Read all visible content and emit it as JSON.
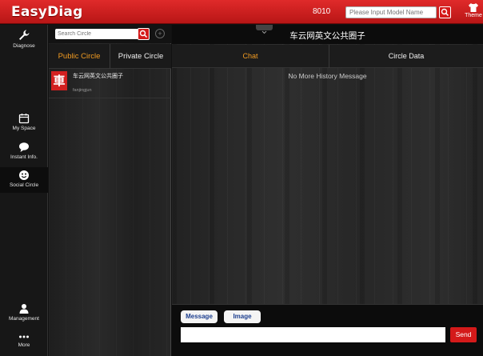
{
  "app": {
    "logo": "EasyDiag",
    "model_code": "8010",
    "model_search_placeholder": "Please Input Model Name",
    "theme_label": "Theme"
  },
  "nav": {
    "items": [
      {
        "label": "Diagnose",
        "icon": "wrench-icon"
      },
      {
        "label": "My Space",
        "icon": "calendar-icon"
      },
      {
        "label": "Instant Info.",
        "icon": "chat-bubble-icon"
      },
      {
        "label": "Social Circle",
        "icon": "smiley-icon"
      },
      {
        "label": "Management",
        "icon": "person-icon"
      },
      {
        "label": "More",
        "icon": "ellipsis-icon"
      }
    ],
    "active": "Social Circle"
  },
  "circles": {
    "search_placeholder": "Search Circle",
    "tabs": [
      {
        "label": "Public Circle",
        "active": true
      },
      {
        "label": "Private Circle",
        "active": false
      }
    ],
    "items": [
      {
        "avatar_char": "車",
        "name": "车云网英文公共圈子",
        "owner": "fanjingjun"
      }
    ]
  },
  "chat": {
    "title": "车云网英文公共圈子",
    "tabs": [
      {
        "label": "Chat",
        "active": true
      },
      {
        "label": "Circle Data",
        "active": false
      }
    ],
    "history_message": "No More History Message",
    "composer": {
      "message_button": "Message",
      "image_button": "Image",
      "input_value": "",
      "send_button": "Send"
    }
  },
  "colors": {
    "brand_red": "#d41a1a",
    "active_tab": "#f29b22",
    "button_text_blue": "#1d3f8f"
  }
}
